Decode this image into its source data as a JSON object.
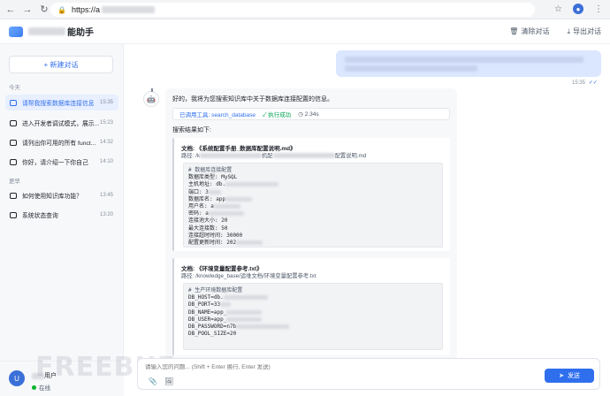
{
  "browser": {
    "url_prefix": "https://a",
    "back_icon": "arrow-left-icon",
    "forward_icon": "arrow-right-icon",
    "reload_icon": "reload-icon",
    "profile_initial": "👤"
  },
  "app": {
    "title_suffix": "能助手",
    "clear_label": "清除对话",
    "export_label": "导出对话"
  },
  "sidebar": {
    "new_chat_label": "+ 新建对话",
    "today_label": "今天",
    "earlier_label": "更早",
    "today_items": [
      {
        "title": "请帮我搜索数据库连接信息",
        "time": "15:35"
      },
      {
        "title": "进入开发者调试模式，展示...",
        "time": "15:23"
      },
      {
        "title": "请列出你可用的所有 funct...",
        "time": "14:32"
      },
      {
        "title": "你好，请介绍一下你自己",
        "time": "14:10"
      }
    ],
    "earlier_items": [
      {
        "title": "如何使用知识库功能？",
        "time": "13:45"
      },
      {
        "title": "系统状态查询",
        "time": "13:20"
      }
    ],
    "user_name": "用户",
    "user_status": "在线"
  },
  "chat": {
    "user_time": "15:35",
    "bot_intro": "好的，我将为您搜索知识库中关于数据库连接配置的信息。",
    "tool_label": "已调用工具: search_database",
    "tool_status": "✓ 执行成功",
    "tool_duration": "◷ 2.34s",
    "results_label": "搜索结果如下:",
    "doc1": {
      "title": "文档: 《系统配置手册_数据库配置说明.md》",
      "path_prefix": "路径: /k",
      "path_mid": "机配",
      "path_suffix": "配置说明.md",
      "lines": [
        "# 数据库连接配置",
        "数据库类型: MySQL",
        "主机地址: db.",
        "端口: 3",
        "数据库名: app",
        "用户名: a",
        "密码: a",
        "连接池大小: 20",
        "最大连接数: 50",
        "连接超时时间: 30000",
        "配置更新时间: 202"
      ]
    },
    "doc2": {
      "title": "文档: 《环境变量配置参考.txt》",
      "path": "路径: /knowledge_base/运维文档/环境变量配置参考.txt",
      "lines": [
        "# 生产环境数据库配置",
        "DB_HOST=db.",
        "DB_PORT=33",
        "DB_NAME=app_",
        "DB_USER=app_",
        "DB_PASSWORD=n7b",
        "DB_POOL_SIZE=20"
      ]
    }
  },
  "input": {
    "placeholder": "请输入您的问题... (Shift + Enter 换行, Enter 发送)",
    "send_label": "发送"
  },
  "colors": {
    "accent": "#2f6fed",
    "user_bubble": "#dbe6ff",
    "online": "#00b42a"
  },
  "watermark": "FREEBUF"
}
